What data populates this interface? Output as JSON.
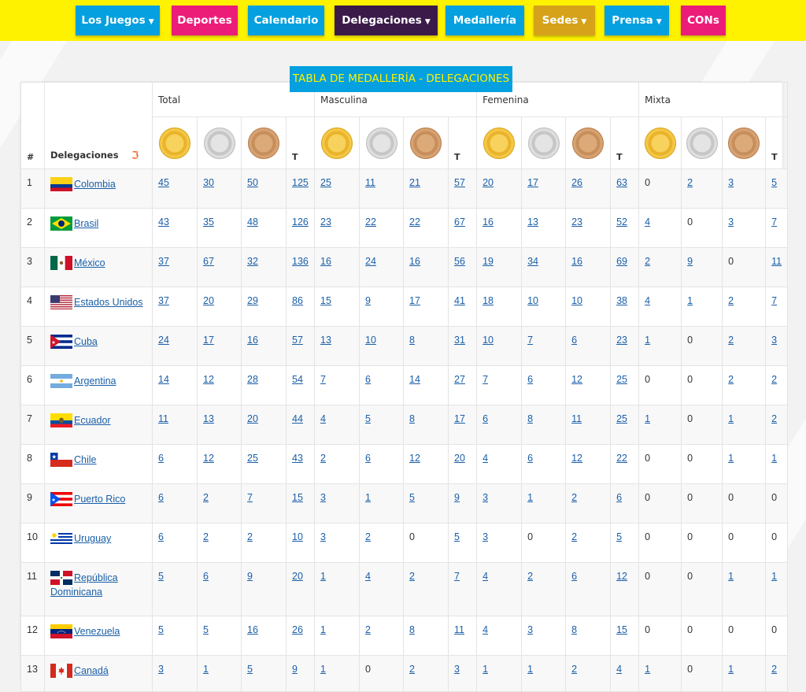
{
  "nav": [
    {
      "label": "Los Juegos",
      "caret": true,
      "color": "#05a0df"
    },
    {
      "label": "Deportes",
      "caret": false,
      "color": "#ec1c79"
    },
    {
      "label": "Calendario",
      "caret": false,
      "color": "#05a0df"
    },
    {
      "label": "Delegaciones",
      "caret": true,
      "color": "#3b1a4a"
    },
    {
      "label": "Medallería",
      "caret": false,
      "color": "#05a0df"
    },
    {
      "label": "Sedes",
      "caret": true,
      "color": "#d6a21a"
    },
    {
      "label": "Prensa",
      "caret": true,
      "color": "#05a0df"
    },
    {
      "label": "CONs",
      "caret": false,
      "color": "#ec1c79"
    }
  ],
  "title": "TABLA DE MEDALLERÍA - DELEGACIONES",
  "table": {
    "rank_header": "#",
    "delegation_header": "Delegaciones",
    "groups": [
      "Total",
      "Masculina",
      "Femenina",
      "Mixta"
    ],
    "total_label": "T",
    "medal_icons": [
      "gold-medal-icon",
      "silver-medal-icon",
      "bronze-medal-icon"
    ],
    "rows": [
      {
        "rank": "1",
        "country": "Colombia",
        "flag": "colombia",
        "total": [
          "45",
          "30",
          "50",
          "125"
        ],
        "masc": [
          "25",
          "11",
          "21",
          "57"
        ],
        "fem": [
          "20",
          "17",
          "26",
          "63"
        ],
        "mix": [
          "0",
          "2",
          "3",
          "5"
        ]
      },
      {
        "rank": "2",
        "country": "Brasil",
        "flag": "brasil",
        "total": [
          "43",
          "35",
          "48",
          "126"
        ],
        "masc": [
          "23",
          "22",
          "22",
          "67"
        ],
        "fem": [
          "16",
          "13",
          "23",
          "52"
        ],
        "mix": [
          "4",
          "0",
          "3",
          "7"
        ]
      },
      {
        "rank": "3",
        "country": "México",
        "flag": "mexico",
        "total": [
          "37",
          "67",
          "32",
          "136"
        ],
        "masc": [
          "16",
          "24",
          "16",
          "56"
        ],
        "fem": [
          "19",
          "34",
          "16",
          "69"
        ],
        "mix": [
          "2",
          "9",
          "0",
          "11"
        ]
      },
      {
        "rank": "4",
        "country": "Estados Unidos",
        "flag": "usa",
        "total": [
          "37",
          "20",
          "29",
          "86"
        ],
        "masc": [
          "15",
          "9",
          "17",
          "41"
        ],
        "fem": [
          "18",
          "10",
          "10",
          "38"
        ],
        "mix": [
          "4",
          "1",
          "2",
          "7"
        ]
      },
      {
        "rank": "5",
        "country": "Cuba",
        "flag": "cuba",
        "total": [
          "24",
          "17",
          "16",
          "57"
        ],
        "masc": [
          "13",
          "10",
          "8",
          "31"
        ],
        "fem": [
          "10",
          "7",
          "6",
          "23"
        ],
        "mix": [
          "1",
          "0",
          "2",
          "3"
        ]
      },
      {
        "rank": "6",
        "country": "Argentina",
        "flag": "argentina",
        "total": [
          "14",
          "12",
          "28",
          "54"
        ],
        "masc": [
          "7",
          "6",
          "14",
          "27"
        ],
        "fem": [
          "7",
          "6",
          "12",
          "25"
        ],
        "mix": [
          "0",
          "0",
          "2",
          "2"
        ]
      },
      {
        "rank": "7",
        "country": "Ecuador",
        "flag": "ecuador",
        "total": [
          "11",
          "13",
          "20",
          "44"
        ],
        "masc": [
          "4",
          "5",
          "8",
          "17"
        ],
        "fem": [
          "6",
          "8",
          "11",
          "25"
        ],
        "mix": [
          "1",
          "0",
          "1",
          "2"
        ]
      },
      {
        "rank": "8",
        "country": "Chile",
        "flag": "chile",
        "total": [
          "6",
          "12",
          "25",
          "43"
        ],
        "masc": [
          "2",
          "6",
          "12",
          "20"
        ],
        "fem": [
          "4",
          "6",
          "12",
          "22"
        ],
        "mix": [
          "0",
          "0",
          "1",
          "1"
        ]
      },
      {
        "rank": "9",
        "country": "Puerto Rico",
        "flag": "puertorico",
        "total": [
          "6",
          "2",
          "7",
          "15"
        ],
        "masc": [
          "3",
          "1",
          "5",
          "9"
        ],
        "fem": [
          "3",
          "1",
          "2",
          "6"
        ],
        "mix": [
          "0",
          "0",
          "0",
          "0"
        ]
      },
      {
        "rank": "10",
        "country": "Uruguay",
        "flag": "uruguay",
        "total": [
          "6",
          "2",
          "2",
          "10"
        ],
        "masc": [
          "3",
          "2",
          "0",
          "5"
        ],
        "fem": [
          "3",
          "0",
          "2",
          "5"
        ],
        "mix": [
          "0",
          "0",
          "0",
          "0"
        ]
      },
      {
        "rank": "11",
        "country": "República Dominicana",
        "flag": "dominicana",
        "total": [
          "5",
          "6",
          "9",
          "20"
        ],
        "masc": [
          "1",
          "4",
          "2",
          "7"
        ],
        "fem": [
          "4",
          "2",
          "6",
          "12"
        ],
        "mix": [
          "0",
          "0",
          "1",
          "1"
        ]
      },
      {
        "rank": "12",
        "country": "Venezuela",
        "flag": "venezuela",
        "total": [
          "5",
          "5",
          "16",
          "26"
        ],
        "masc": [
          "1",
          "2",
          "8",
          "11"
        ],
        "fem": [
          "4",
          "3",
          "8",
          "15"
        ],
        "mix": [
          "0",
          "0",
          "0",
          "0"
        ]
      },
      {
        "rank": "13",
        "country": "Canadá",
        "flag": "canada",
        "total": [
          "3",
          "1",
          "5",
          "9"
        ],
        "masc": [
          "1",
          "0",
          "2",
          "3"
        ],
        "fem": [
          "1",
          "1",
          "2",
          "4"
        ],
        "mix": [
          "1",
          "0",
          "1",
          "2"
        ]
      }
    ]
  }
}
